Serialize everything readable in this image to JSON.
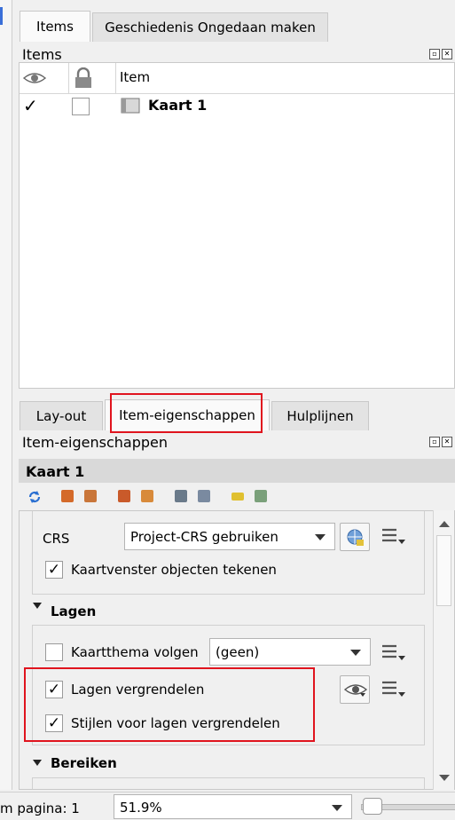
{
  "top_tabs": [
    "Items",
    "Geschiedenis Ongedaan maken"
  ],
  "items_panel": {
    "title": "Items",
    "col_item": "Item",
    "rows": [
      {
        "visible": "✓",
        "name": "Kaart 1"
      }
    ]
  },
  "bottom_tabs": [
    "Lay-out",
    "Item-eigenschappen",
    "Hulplijnen"
  ],
  "props_panel": {
    "title": "Item-eigenschappen",
    "item_name": "Kaart 1",
    "crs_label": "CRS",
    "crs_value": "Project-CRS gebruiken",
    "draw_objects_label": "Kaartvenster objecten tekenen",
    "draw_objects_check": "✓",
    "layers_section": "Lagen",
    "follow_theme_label": "Kaartthema volgen",
    "theme_value": "(geen)",
    "lock_layers_label": "Lagen vergrendelen",
    "lock_layers_check": "✓",
    "lock_styles_label": "Stijlen voor lagen vergrendelen",
    "lock_styles_check": "✓",
    "extents_section": "Bereiken"
  },
  "status": {
    "page_label": "m pagina: 1",
    "zoom_value": "51.9%"
  },
  "colors": {
    "highlight": "#e0141e"
  }
}
